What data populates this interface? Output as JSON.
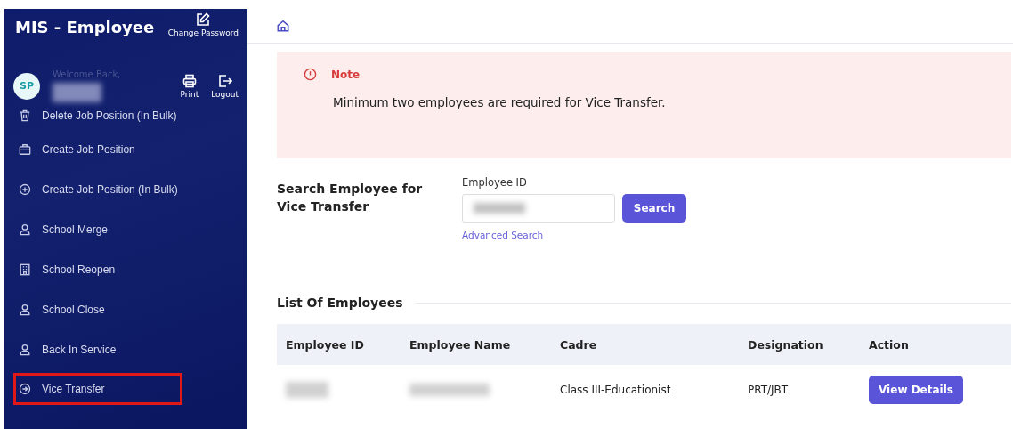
{
  "sidebar": {
    "title": "MIS - Employee",
    "change_password": "Change Password",
    "welcome": "Welcome Back,",
    "avatar": "SP",
    "print": "Print",
    "logout": "Logout",
    "items": [
      {
        "label": "Delete Job Position (In Bulk)",
        "selected": false
      },
      {
        "label": "Create Job Position",
        "selected": false
      },
      {
        "label": "Create Job Position (In Bulk)",
        "selected": false
      },
      {
        "label": "School Merge",
        "selected": false
      },
      {
        "label": "School Reopen",
        "selected": false
      },
      {
        "label": "School Close",
        "selected": false
      },
      {
        "label": "Back In Service",
        "selected": false
      },
      {
        "label": "Vice Transfer",
        "selected": true
      }
    ]
  },
  "note": {
    "title": "Note",
    "message": "Minimum two employees are required for Vice Transfer."
  },
  "search": {
    "heading": "Search Employee for Vice Transfer",
    "field_label": "Employee ID",
    "button": "Search",
    "advanced": "Advanced Search"
  },
  "list": {
    "heading": "List Of Employees",
    "columns": [
      "Employee ID",
      "Employee Name",
      "Cadre",
      "Designation",
      "Action"
    ],
    "rows": [
      {
        "cadre": "Class III-Educationist",
        "designation": "PRT/JBT",
        "action": "View Details"
      }
    ]
  }
}
